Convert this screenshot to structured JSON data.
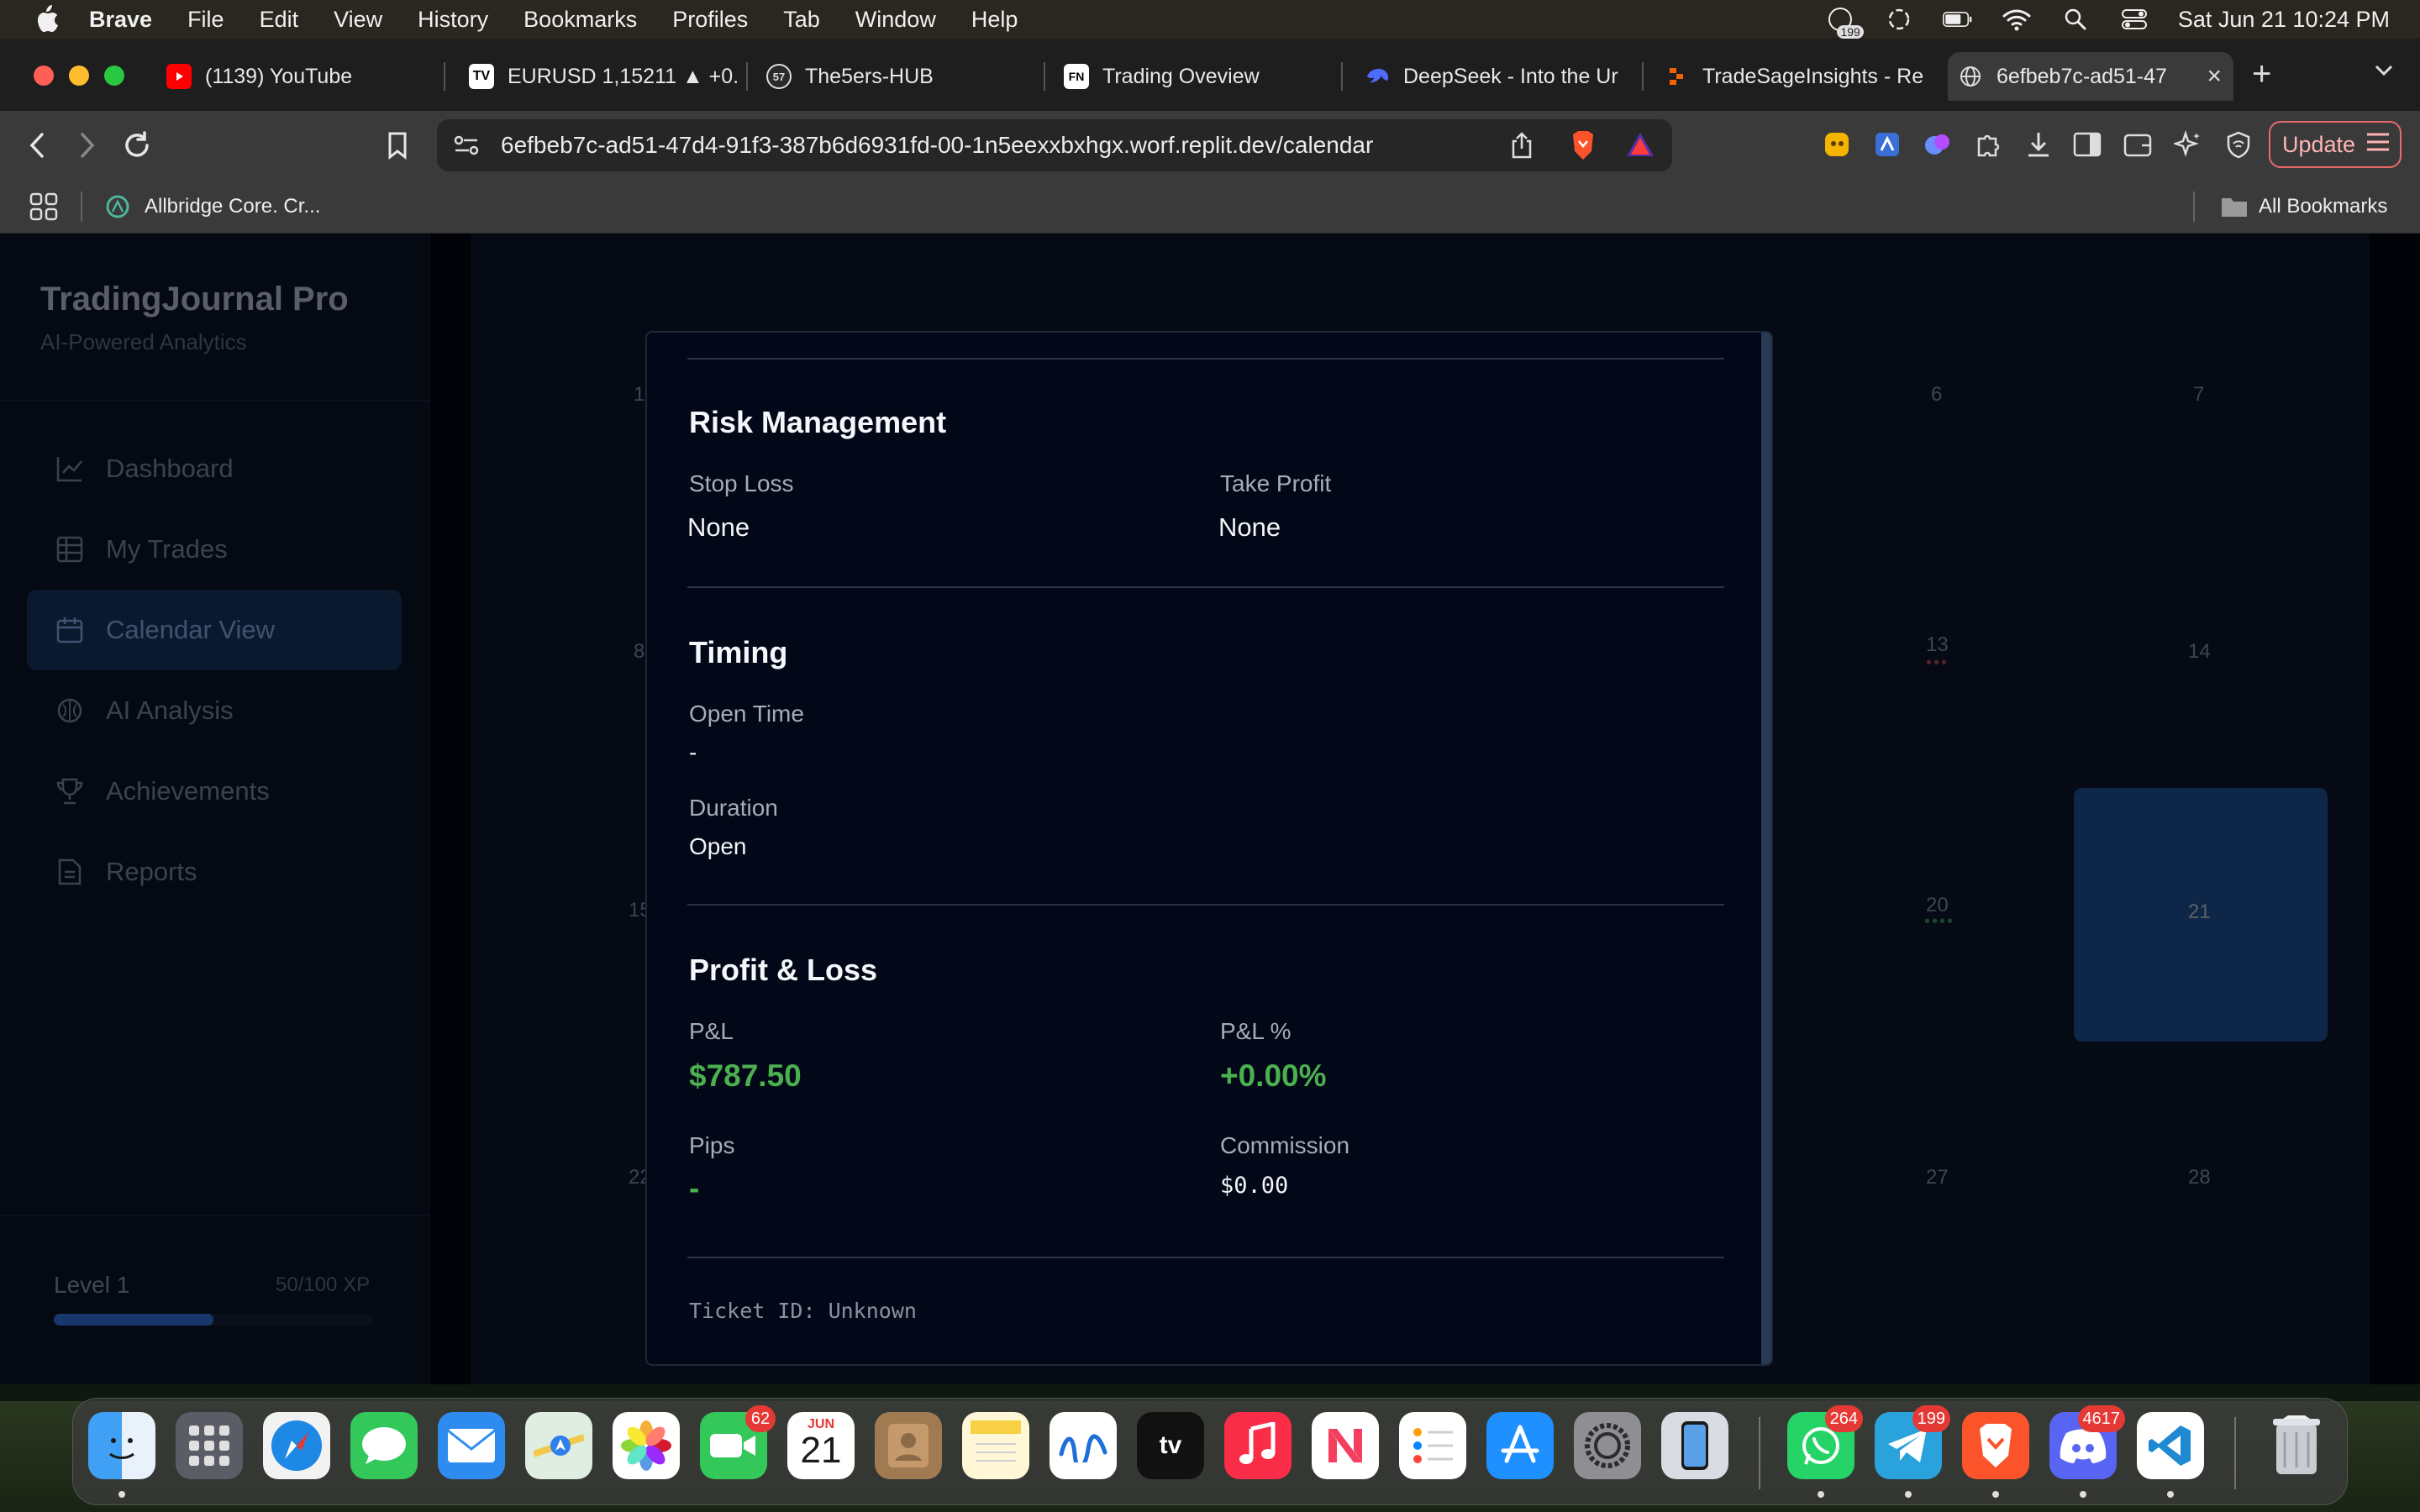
{
  "menubar": {
    "app_name": "Brave",
    "items": [
      "File",
      "Edit",
      "View",
      "History",
      "Bookmarks",
      "Profiles",
      "Tab",
      "Window",
      "Help"
    ],
    "notification_count": "199",
    "datetime": "Sat Jun 21  10:24 PM"
  },
  "browser": {
    "tabs": [
      {
        "label": "(1139) YouTube",
        "icon": "youtube-icon"
      },
      {
        "label": "EURUSD 1,15211 ▲ +0.",
        "icon": "tradingview-icon"
      },
      {
        "label": "The5ers-HUB",
        "icon": "the5ers-icon"
      },
      {
        "label": "Trading Oveview",
        "icon": "fn-icon"
      },
      {
        "label": "DeepSeek - Into the Ur",
        "icon": "deepseek-icon"
      },
      {
        "label": "TradeSageInsights - Re",
        "icon": "replit-icon"
      },
      {
        "label": "6efbeb7c-ad51-47",
        "icon": "globe-icon"
      }
    ],
    "url": "6efbeb7c-ad51-47d4-91f3-387b6d6931fd-00-1n5eexxbxhgx.worf.replit.dev/calendar",
    "update_label": "Update",
    "bookmark_item": "Allbridge Core. Cr...",
    "all_bookmarks": "All Bookmarks"
  },
  "sidebar": {
    "brand": "TradingJournal Pro",
    "tagline": "AI-Powered Analytics",
    "items": [
      {
        "label": "Dashboard",
        "icon": "chart-line-icon"
      },
      {
        "label": "My Trades",
        "icon": "table-icon"
      },
      {
        "label": "Calendar View",
        "icon": "calendar-icon"
      },
      {
        "label": "AI Analysis",
        "icon": "brain-icon"
      },
      {
        "label": "Achievements",
        "icon": "trophy-icon"
      },
      {
        "label": "Reports",
        "icon": "document-icon"
      }
    ],
    "level": "Level 1",
    "xp": "50/100 XP",
    "xp_progress": 0.5
  },
  "calendar": {
    "days": [
      "1",
      "6",
      "7",
      "8",
      "13",
      "14",
      "15",
      "20",
      "21",
      "22",
      "27",
      "28"
    ]
  },
  "modal": {
    "risk": {
      "title": "Risk Management",
      "stop_loss_label": "Stop Loss",
      "stop_loss_value": "None",
      "take_profit_label": "Take Profit",
      "take_profit_value": "None"
    },
    "timing": {
      "title": "Timing",
      "open_time_label": "Open Time",
      "open_time_value": "-",
      "duration_label": "Duration",
      "duration_value": "Open"
    },
    "pnl": {
      "title": "Profit & Loss",
      "pnl_label": "P&L",
      "pnl_value": "$787.50",
      "pnl_pct_label": "P&L %",
      "pnl_pct_value": "+0.00%",
      "pips_label": "Pips",
      "pips_value": "-",
      "commission_label": "Commission",
      "commission_value": "$0.00"
    },
    "ticket": "Ticket ID: Unknown"
  },
  "dock": {
    "badges": {
      "facetime": "62",
      "whatsapp": "264",
      "telegram": "199",
      "discord": "4617"
    },
    "calendar_month": "JUN",
    "calendar_day": "21",
    "appletv_label": "tv"
  },
  "colors": {
    "positive": "#4caf50",
    "accent": "#1c3a66",
    "modal_bg": "#020817"
  }
}
